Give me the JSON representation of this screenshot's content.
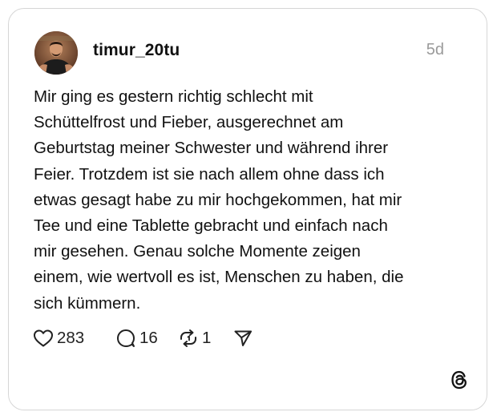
{
  "post": {
    "username": "timur_20tu",
    "timestamp": "5d",
    "text_lines": [
      "Mir ging es gestern richtig schlecht mit",
      "Schüttelfrost und Fieber, ausgerechnet am",
      "Geburtstag meiner Schwester und während ihrer",
      "Feier. Trotzdem ist sie nach allem ohne dass ich",
      "etwas gesagt habe zu mir hochgekommen, hat mir",
      "Tee und eine Tablette gebracht und einfach nach",
      "mir gesehen. Genau solche Momente zeigen",
      "einem, wie wertvoll es ist, Menschen zu haben, die",
      "sich kümmern."
    ]
  },
  "actions": {
    "likes": "283",
    "replies": "16",
    "reposts": "1"
  },
  "icons": {
    "like": "heart-icon",
    "reply": "speech-bubble-icon",
    "repost": "repost-arrows-icon",
    "share": "send-icon",
    "brand": "threads-logo-icon"
  }
}
